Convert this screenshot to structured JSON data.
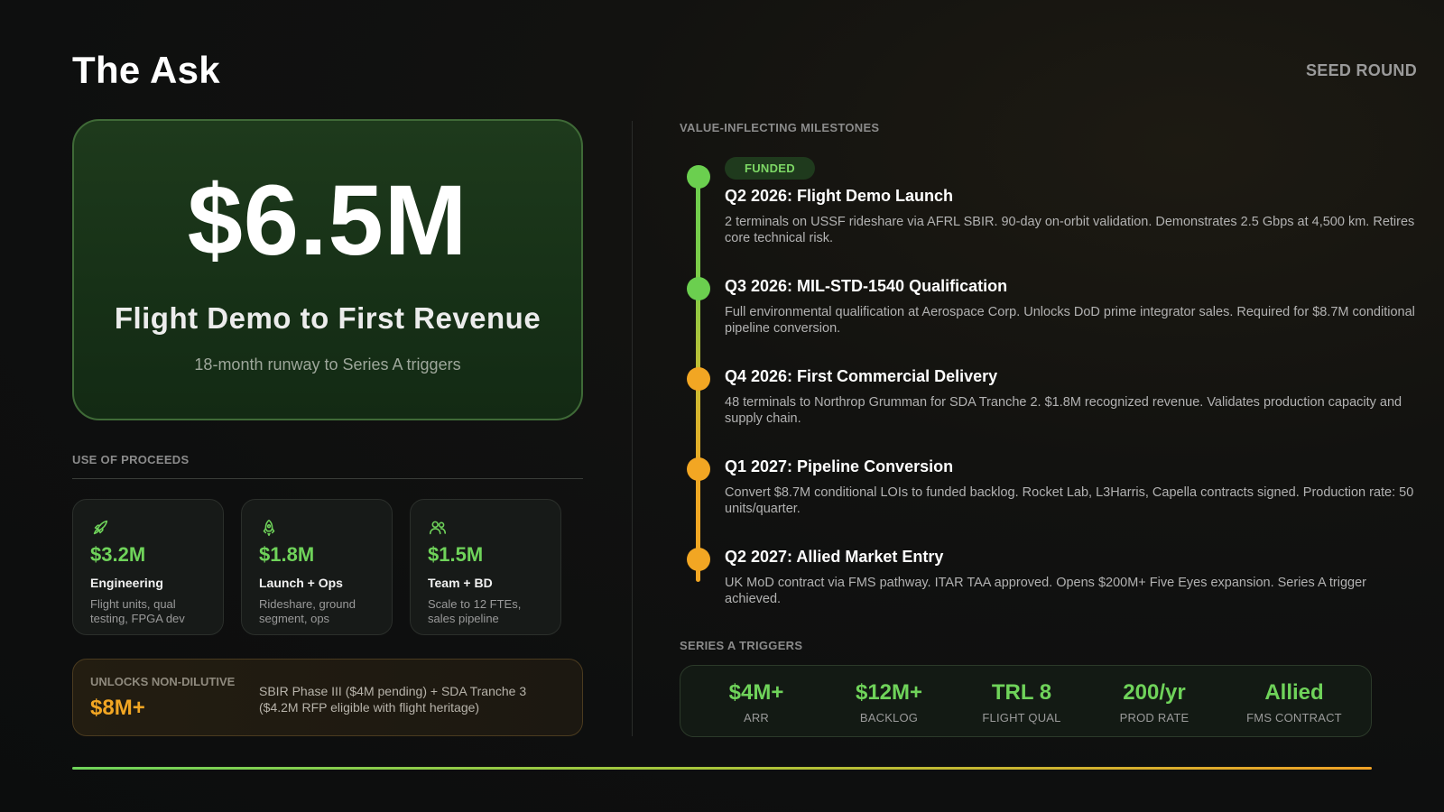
{
  "header": {
    "title": "The Ask",
    "round_label": "SEED ROUND"
  },
  "hero": {
    "amount": "$6.5M",
    "subtitle": "Flight Demo to First Revenue",
    "note": "18-month runway to Series A triggers"
  },
  "proceeds": {
    "label": "USE OF PROCEEDS",
    "items": [
      {
        "icon": "rocket-icon",
        "amount": "$3.2M",
        "name": "Engineering",
        "desc": "Flight units, qual testing, FPGA dev"
      },
      {
        "icon": "launch-icon",
        "amount": "$1.8M",
        "name": "Launch + Ops",
        "desc": "Rideshare, ground segment, ops"
      },
      {
        "icon": "team-icon",
        "amount": "$1.5M",
        "name": "Team + BD",
        "desc": "Scale to 12 FTEs, sales pipeline"
      }
    ]
  },
  "unlock": {
    "label": "UNLOCKS NON-DILUTIVE",
    "amount": "$8M+",
    "text": "SBIR Phase III ($4M pending) + SDA Tranche 3 ($4.2M RFP eligible with flight heritage)"
  },
  "milestones": {
    "label": "VALUE-INFLECTING MILESTONES",
    "funded_badge": "FUNDED",
    "items": [
      {
        "title": "Q2 2026: Flight Demo Launch",
        "desc": "2 terminals on USSF rideshare via AFRL SBIR. 90-day on-orbit validation. Demonstrates 2.5 Gbps at 4,500 km. Retires core technical risk.",
        "status_color": "#6bcf4f"
      },
      {
        "title": "Q3 2026: MIL-STD-1540 Qualification",
        "desc": "Full environmental qualification at Aerospace Corp. Unlocks DoD prime integrator sales. Required for $8.7M conditional pipeline conversion.",
        "status_color": "#6bcf4f"
      },
      {
        "title": "Q4 2026: First Commercial Delivery",
        "desc": "48 terminals to Northrop Grumman for SDA Tranche 2. $1.8M recognized revenue. Validates production capacity and supply chain.",
        "status_color": "#f2a623"
      },
      {
        "title": "Q1 2027: Pipeline Conversion",
        "desc": "Convert $8.7M conditional LOIs to funded backlog. Rocket Lab, L3Harris, Capella contracts signed. Production rate: 50 units/quarter.",
        "status_color": "#f2a623"
      },
      {
        "title": "Q2 2027: Allied Market Entry",
        "desc": "UK MoD contract via FMS pathway. ITAR TAA approved. Opens $200M+ Five Eyes expansion. Series A trigger achieved.",
        "status_color": "#f2a623"
      }
    ]
  },
  "triggers": {
    "label": "SERIES A TRIGGERS",
    "items": [
      {
        "value": "$4M+",
        "label": "ARR"
      },
      {
        "value": "$12M+",
        "label": "BACKLOG"
      },
      {
        "value": "TRL 8",
        "label": "FLIGHT QUAL"
      },
      {
        "value": "200/yr",
        "label": "PROD RATE"
      },
      {
        "value": "Allied",
        "label": "FMS CONTRACT"
      }
    ]
  },
  "colors": {
    "accent_green": "#6fd35a",
    "accent_amber": "#f2a623",
    "background": "#0e0f0f"
  }
}
